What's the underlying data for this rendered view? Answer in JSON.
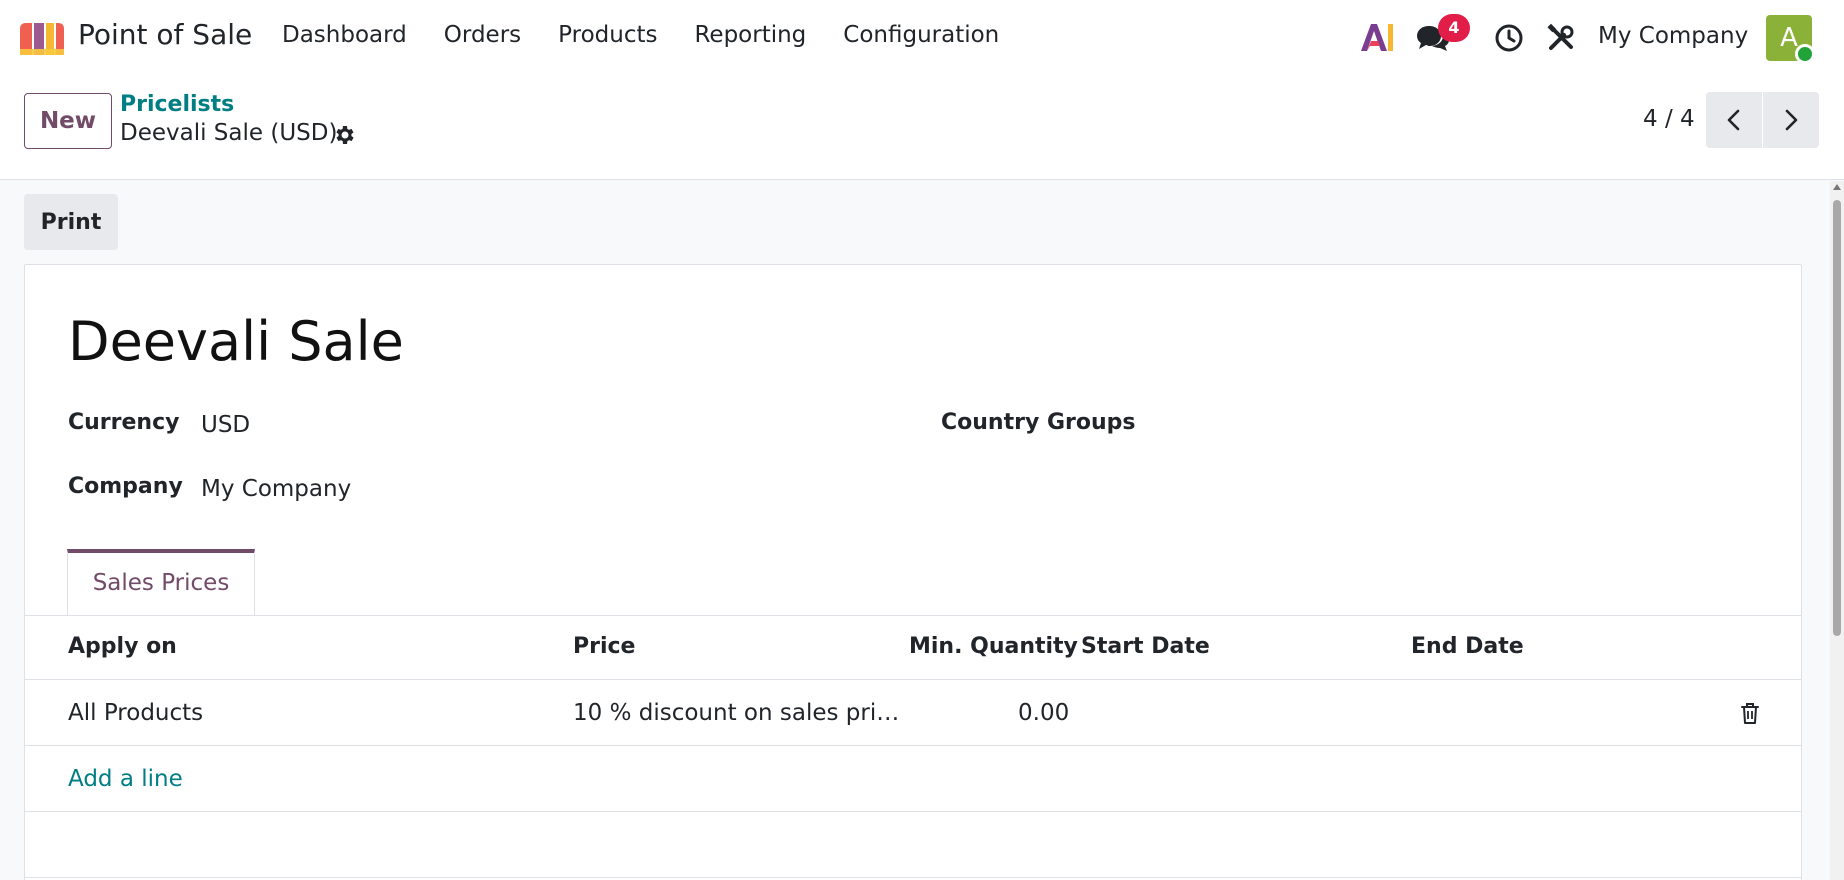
{
  "app": {
    "name": "Point of Sale"
  },
  "menu": [
    "Dashboard",
    "Orders",
    "Products",
    "Reporting",
    "Configuration"
  ],
  "systray": {
    "ai_label": "AI",
    "message_count": "4",
    "company": "My Company",
    "avatar_initial": "A"
  },
  "control_panel": {
    "new_label": "New",
    "breadcrumb": "Pricelists",
    "record_title": "Deevali Sale (USD)",
    "pager": "4 / 4"
  },
  "actions": {
    "print_label": "Print"
  },
  "form": {
    "title": "Deevali Sale",
    "currency_label": "Currency",
    "currency_value": "USD",
    "company_label": "Company",
    "company_value": "My Company",
    "country_groups_label": "Country Groups"
  },
  "tabs": [
    {
      "label": "Sales Prices",
      "active": true
    }
  ],
  "table": {
    "headers": [
      "Apply on",
      "Price",
      "Min. Quantity",
      "Start Date",
      "End Date"
    ],
    "rows": [
      {
        "apply_on": "All Products",
        "price": "10 % discount on sales pri…",
        "min_qty": "0.00",
        "start": "",
        "end": ""
      }
    ],
    "add_line": "Add a line"
  },
  "colors": {
    "brand": "#714b67",
    "link": "#017e84",
    "badge": "#e11d48",
    "avatar": "#8bb139",
    "online": "#22a33a"
  }
}
